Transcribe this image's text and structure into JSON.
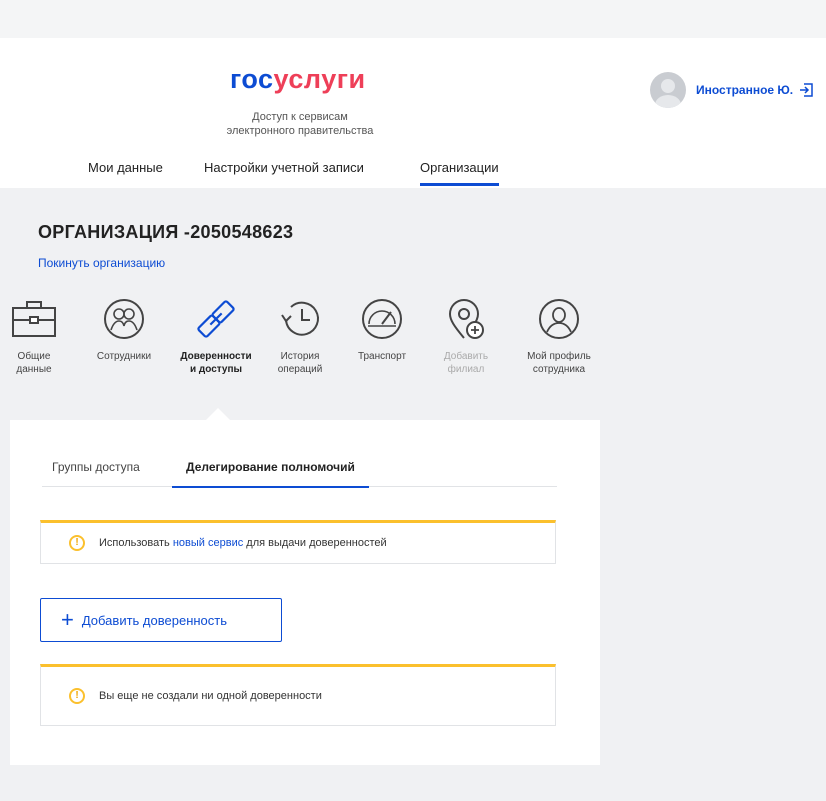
{
  "header": {
    "logo_part1": "гос",
    "logo_part2": "услуги",
    "tagline_line1": "Доступ к сервисам",
    "tagline_line2": "электронного правительства",
    "user_name": "Иностранное Ю.",
    "nav": [
      "Мои данные",
      "Настройки учетной записи",
      "Организации"
    ]
  },
  "org": {
    "title": "ОРГАНИЗАЦИЯ -2050548623",
    "leave_link": "Покинуть организацию"
  },
  "tiles": [
    {
      "line1": "Общие",
      "line2": "данные"
    },
    {
      "line1": "Сотрудники",
      "line2": ""
    },
    {
      "line1": "Доверенности",
      "line2": "и доступы"
    },
    {
      "line1": "История",
      "line2": "операций"
    },
    {
      "line1": "Транспорт",
      "line2": ""
    },
    {
      "line1": "Добавить",
      "line2": "филиал"
    },
    {
      "line1": "Мой профиль",
      "line2": "сотрудника"
    }
  ],
  "subtabs": [
    "Группы доступа",
    "Делегирование полномочий"
  ],
  "notice1": {
    "prefix": "Использовать ",
    "link": "новый сервис",
    "suffix": " для выдачи доверенностей"
  },
  "add_button": "Добавить доверенность",
  "notice2": "Вы еще не создали ни одной доверенности",
  "colors": {
    "accent": "#0d4cd3",
    "logo_red": "#ee3f58",
    "warning": "#fbc02d"
  }
}
